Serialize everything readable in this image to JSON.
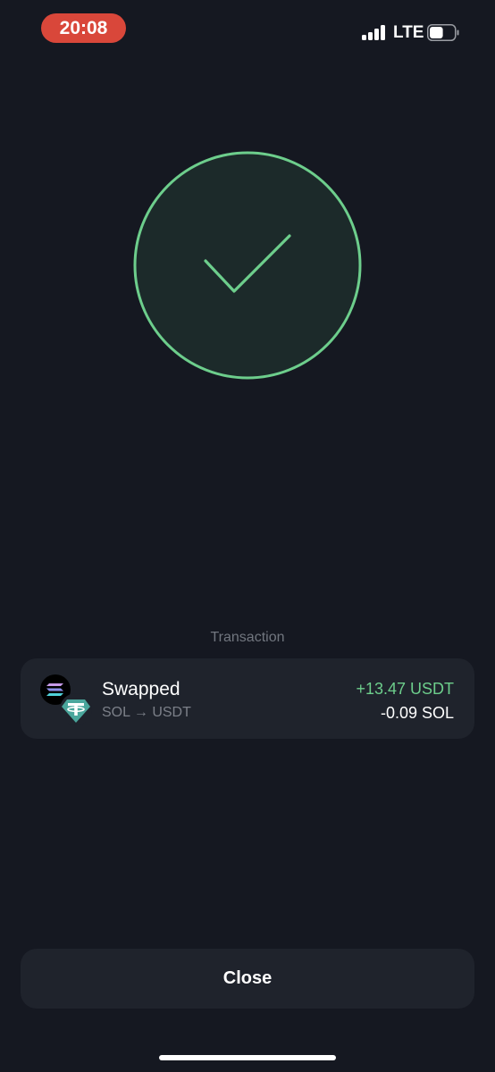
{
  "status_bar": {
    "time": "20:08",
    "network": "LTE",
    "signal_bars": 4,
    "battery_level": 0.55,
    "time_pill_color": "#d9473a"
  },
  "success": {
    "icon": "checkmark-icon",
    "accent_color": "#6dce8c"
  },
  "transaction": {
    "section_label": "Transaction",
    "title": "Swapped",
    "pair": "SOL → USDT",
    "from_token_icon": "solana-icon",
    "to_token_icon": "tether-icon",
    "amount_in": "+13.47 USDT",
    "amount_out": "-0.09 SOL",
    "positive_color": "#6dce8c"
  },
  "close_button": {
    "label": "Close"
  }
}
